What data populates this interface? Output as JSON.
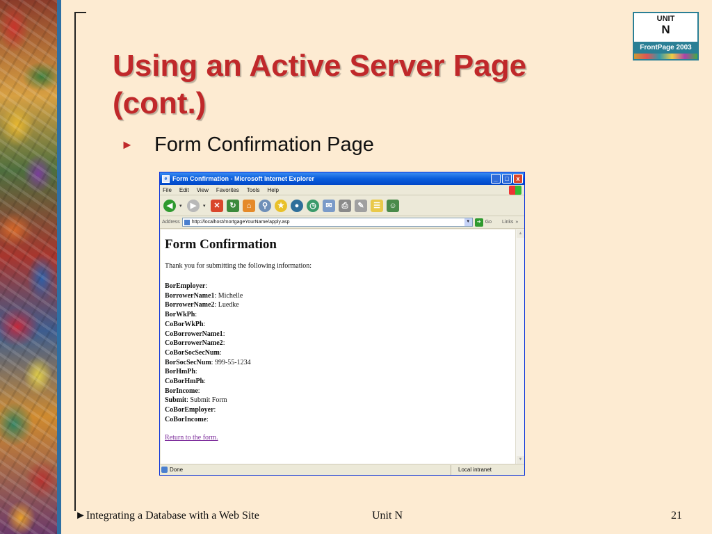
{
  "slide": {
    "title_line1": "Using an Active Server Page",
    "title_line2": "(cont.)",
    "bullet_marker": "►",
    "bullet_text": "Form Confirmation Page",
    "logo": {
      "unit_label": "UNIT",
      "unit_letter": "N",
      "product": "FrontPage 2003"
    },
    "footer": {
      "left_marker": "►",
      "left": "Integrating a Database with a Web Site",
      "center": "Unit N",
      "page_number": "21"
    },
    "colors": {
      "title": "#C0282A",
      "background": "#FDEBD2",
      "accent_bar": "#2E6FA3"
    }
  },
  "browser": {
    "window_title": "Form Confirmation - Microsoft Internet Explorer",
    "window_buttons": {
      "minimize": "_",
      "maximize": "□",
      "close": "x"
    },
    "menu": [
      "File",
      "Edit",
      "View",
      "Favorites",
      "Tools",
      "Help"
    ],
    "toolbar_icons": [
      "back-icon",
      "forward-icon",
      "stop-icon",
      "refresh-icon",
      "home-icon",
      "search-icon",
      "favorites-icon",
      "media-icon",
      "history-icon",
      "mail-icon",
      "print-icon",
      "edit-icon",
      "discuss-icon",
      "messenger-icon"
    ],
    "address_label": "Address",
    "address_url": "http://localhost/mortgageYourName/apply.asp",
    "go_label": "Go",
    "links_label": "Links",
    "page": {
      "heading": "Form Confirmation",
      "intro": "Thank you for submitting the following information:",
      "fields": [
        {
          "name": "BorEmployer",
          "value": ""
        },
        {
          "name": "BorrowerName1",
          "value": "Michelle"
        },
        {
          "name": "BorrowerName2",
          "value": "Luedke"
        },
        {
          "name": "BorWkPh",
          "value": ""
        },
        {
          "name": "CoBorWkPh",
          "value": ""
        },
        {
          "name": "CoBorrowerName1",
          "value": ""
        },
        {
          "name": "CoBorrowerName2",
          "value": ""
        },
        {
          "name": "CoBorSocSecNum",
          "value": ""
        },
        {
          "name": "BorSocSecNum",
          "value": "999-55-1234"
        },
        {
          "name": "BorHmPh",
          "value": ""
        },
        {
          "name": "CoBorHmPh",
          "value": ""
        },
        {
          "name": "BorIncome",
          "value": ""
        },
        {
          "name": "Submit",
          "value": "Submit Form"
        },
        {
          "name": "CoBorEmployer",
          "value": ""
        },
        {
          "name": "CoBorIncome",
          "value": ""
        }
      ],
      "return_link": "Return to the form."
    },
    "status": {
      "left": "Done",
      "zone": "Local intranet"
    }
  }
}
